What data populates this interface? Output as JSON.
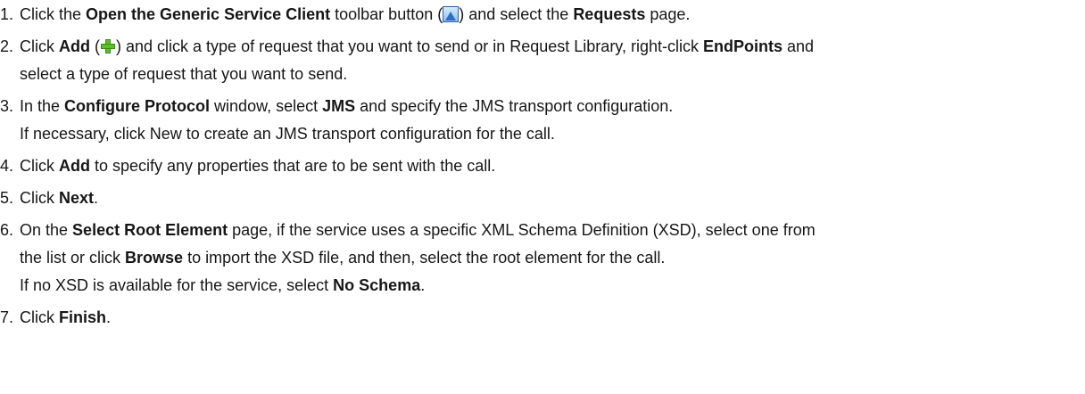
{
  "steps": [
    {
      "num": "1.",
      "a": "Click the ",
      "b1": "Open the Generic Service Client",
      "c": " toolbar button (",
      "icon": "generic-service-client-icon",
      "d": ") and select the ",
      "b2": "Requests",
      "e": " page."
    },
    {
      "num": "2.",
      "a": "Click ",
      "b1": "Add",
      "c": " (",
      "icon": "add-icon",
      "d": ") and click a type of request that you want to send or in Request Library, right-click ",
      "b2": "EndPoints",
      "e": " and",
      "l2": "select a type of request that you want to send."
    },
    {
      "num": "3.",
      "a": "In the ",
      "b1": "Configure Protocol",
      "c": " window, select ",
      "b2": "JMS",
      "d": " and specify the JMS transport configuration.",
      "l2": "If necessary, click New to create an JMS transport configuration for the call."
    },
    {
      "num": "4.",
      "a": "Click ",
      "b1": "Add",
      "c": " to specify any properties that are to be sent with the call."
    },
    {
      "num": "5.",
      "a": "Click ",
      "b1": "Next",
      "c": "."
    },
    {
      "num": "6.",
      "a": "On the ",
      "b1": "Select Root Element",
      "c": " page, if the service uses a specific XML Schema Definition (XSD), select one from",
      "l2a": "the list or click ",
      "l2b": "Browse",
      "l2c": " to import the XSD file, and then, select the root element for the call.",
      "l3a": "If no XSD is available for the service, select ",
      "l3b": "No Schema",
      "l3c": "."
    },
    {
      "num": "7.",
      "a": "Click ",
      "b1": "Finish",
      "c": "."
    }
  ]
}
